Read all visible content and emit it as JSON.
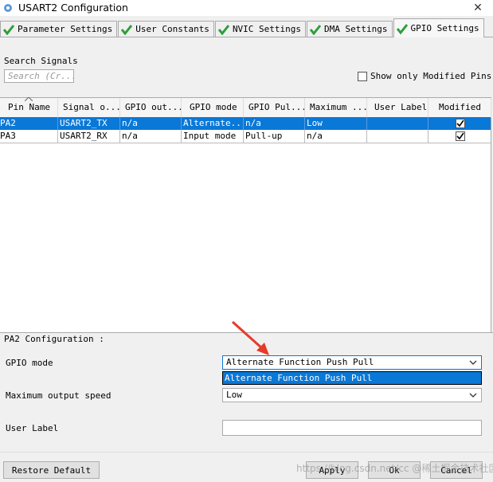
{
  "window": {
    "title": "USART2 Configuration",
    "close_glyph": "✕"
  },
  "tabs": [
    {
      "label": "Parameter Settings",
      "active": false
    },
    {
      "label": "User Constants",
      "active": false
    },
    {
      "label": "NVIC Settings",
      "active": false
    },
    {
      "label": "DMA Settings",
      "active": false
    },
    {
      "label": "GPIO Settings",
      "active": true
    }
  ],
  "search": {
    "label": "Search Signals",
    "placeholder": "Search (Cr..."
  },
  "filter": {
    "label": "Show only Modified Pins",
    "checked": false
  },
  "table": {
    "columns": [
      "Pin Name",
      "Signal o...",
      "GPIO out...",
      "GPIO mode",
      "GPIO Pul...",
      "Maximum ...",
      "User Label",
      "Modified"
    ],
    "rows": [
      {
        "pin": "PA2",
        "signal": "USART2_TX",
        "output": "n/a",
        "mode": "Alternate...",
        "pull": "n/a",
        "speed": "Low",
        "label": "",
        "modified": true,
        "selected": true
      },
      {
        "pin": "PA3",
        "signal": "USART2_RX",
        "output": "n/a",
        "mode": "Input mode",
        "pull": "Pull-up",
        "speed": "n/a",
        "label": "",
        "modified": true,
        "selected": false
      }
    ]
  },
  "config": {
    "title": "PA2 Configuration :",
    "gpio_mode_label": "GPIO mode",
    "gpio_mode_value": "Alternate Function Push Pull",
    "gpio_mode_option": "Alternate Function Push Pull",
    "speed_label": "Maximum output speed",
    "speed_value": "Low",
    "user_label_label": "User Label",
    "user_label_value": ""
  },
  "buttons": {
    "restore": "Restore Default",
    "apply": "Apply",
    "ok": "Ok",
    "cancel": "Cancel"
  },
  "watermark": "https://blog.csdn.net/cc @稀土掘金技术社区",
  "colors": {
    "accent": "#0a78d7",
    "check_green": "#2e9e3a",
    "annotation_red": "#e53a2c"
  }
}
